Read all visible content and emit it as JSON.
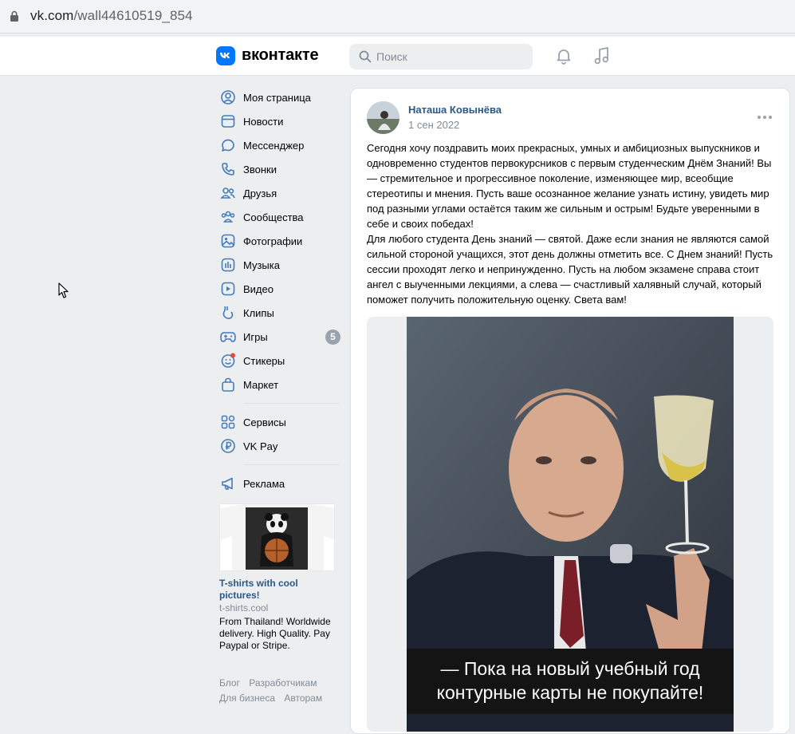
{
  "browser": {
    "url_main": "vk.com",
    "url_path": "/wall44610519_854"
  },
  "header": {
    "logo_text": "вконтакте",
    "search_placeholder": "Поиск"
  },
  "sidebar": {
    "items": [
      {
        "label": "Моя страница",
        "icon": "user-circle-icon"
      },
      {
        "label": "Новости",
        "icon": "news-icon"
      },
      {
        "label": "Мессенджер",
        "icon": "message-icon"
      },
      {
        "label": "Звонки",
        "icon": "phone-icon"
      },
      {
        "label": "Друзья",
        "icon": "friends-icon"
      },
      {
        "label": "Сообщества",
        "icon": "communities-icon"
      },
      {
        "label": "Фотографии",
        "icon": "photo-icon"
      },
      {
        "label": "Музыка",
        "icon": "music-icon"
      },
      {
        "label": "Видео",
        "icon": "video-icon"
      },
      {
        "label": "Клипы",
        "icon": "clips-icon"
      },
      {
        "label": "Игры",
        "icon": "gamepad-icon",
        "badge": "5"
      },
      {
        "label": "Стикеры",
        "icon": "sticker-icon"
      },
      {
        "label": "Маркет",
        "icon": "market-icon"
      }
    ],
    "items2": [
      {
        "label": "Сервисы",
        "icon": "services-icon"
      },
      {
        "label": "VK Pay",
        "icon": "vkpay-icon"
      }
    ],
    "items3": [
      {
        "label": "Реклама",
        "icon": "megaphone-icon"
      }
    ],
    "ad": {
      "title": "T-shirts with cool pictures!",
      "site": "t-shirts.cool",
      "description": "From Thailand! Worldwide delivery. High Quality. Pay Paypal or Stripe."
    },
    "footer": {
      "links": [
        "Блог",
        "Разработчикам",
        "Для бизнеса",
        "Авторам"
      ]
    }
  },
  "post": {
    "author": "Наташа Ковынёва",
    "date": "1 сен 2022",
    "text": "Сегодня хочу поздравить моих прекрасных, умных и амбициозных выпускников и одновременно студентов первокурсников с первым студенческим Днём Знаний! Вы — стремительное и прогрессивное поколение, изменяющее мир, всеобщие стереотипы и мнения. Пусть ваше осознанное желание узнать истину, увидеть мир под разными углами остаётся таким же сильным и острым! Будьте уверенными в себе и своих победах!\nДля любого студента День знаний — святой. Даже если знания не являются самой сильной стороной учащихся, этот день должны отметить все. С Днем знаний! Пусть сессии проходят легко и непринужденно. Пусть на любом экзамене справа стоит ангел с выученными лекциями, а слева — счастливый халявный случай, который поможет получить положительную оценку. Света вам!",
    "image_caption_line1": "— Пока на новый учебный год",
    "image_caption_line2": "контурные карты не покупайте!"
  },
  "colors": {
    "accent": "#0077ff",
    "link": "#2a5885",
    "secondary": "#818c99",
    "bg": "#edeef0"
  }
}
